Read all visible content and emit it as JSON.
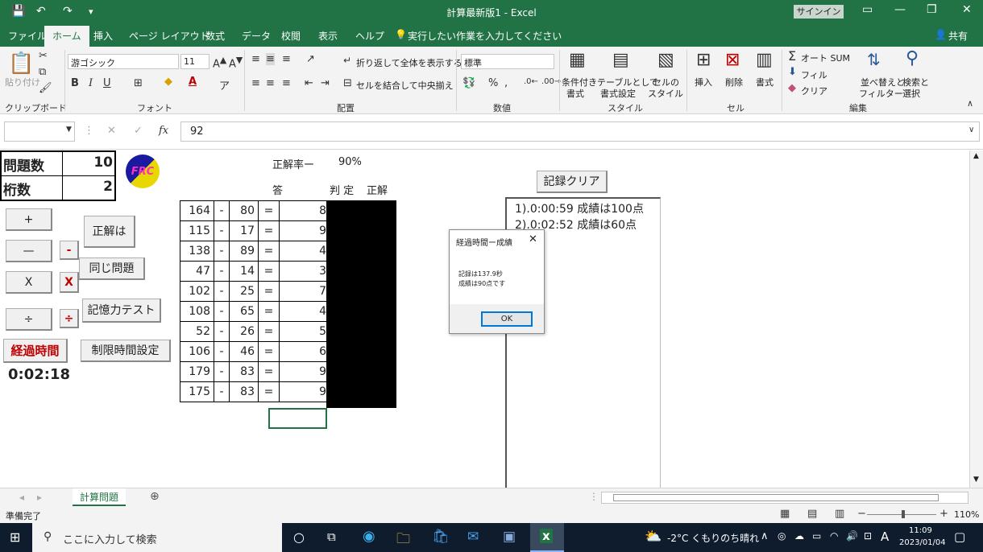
{
  "titlebar": {
    "title": "計算最新版1  -  Excel",
    "signin": "サインイン",
    "quick_access": [
      "save-icon",
      "undo-icon",
      "redo-icon",
      "customize-icon"
    ]
  },
  "menu": {
    "tabs": [
      "ファイル",
      "ホーム",
      "挿入",
      "ページ レイアウト",
      "数式",
      "データ",
      "校閲",
      "表示",
      "ヘルプ"
    ],
    "tellme": "実行したい作業を入力してください",
    "share": "共有"
  },
  "ribbon": {
    "clipboard": {
      "paste": "貼り付け",
      "group": "クリップボード"
    },
    "font": {
      "name": "游ゴシック",
      "size": "11",
      "group": "フォント",
      "bold": "B",
      "italic": "I",
      "underline": "U"
    },
    "align": {
      "wrap": "折り返して全体を表示する",
      "merge": "セルを結合して中央揃え",
      "group": "配置"
    },
    "number": {
      "format": "標準",
      "group": "数値",
      "percent": "%"
    },
    "styles": {
      "cond": [
        "条件付き",
        "書式"
      ],
      "table": [
        "テーブルとして",
        "書式設定"
      ],
      "cell": [
        "セルの",
        "スタイル"
      ],
      "group": "スタイル"
    },
    "cells": {
      "insert": "挿入",
      "delete": "削除",
      "format": "書式",
      "group": "セル"
    },
    "edit": {
      "autosum": "オート SUM",
      "fill": "フィル",
      "clear": "クリア",
      "sort": [
        "並べ替えと",
        "フィルター"
      ],
      "find": [
        "検索と",
        "選択"
      ],
      "group": "編集"
    }
  },
  "formula_bar": {
    "namebox": "",
    "fx": "fx",
    "value": "92"
  },
  "sheet": {
    "info": {
      "q_label": "問題数",
      "q_value": "10",
      "d_label": "桁数",
      "d_value": "2"
    },
    "logo": "FRC",
    "rate_label": "正解率ー",
    "rate_value": "90%",
    "headers": {
      "answer": "答",
      "judge": "判 定",
      "correct": "正解"
    },
    "rows": [
      [
        "164",
        "-",
        "80",
        "=",
        "84"
      ],
      [
        "115",
        "-",
        "17",
        "=",
        "98"
      ],
      [
        "138",
        "-",
        "89",
        "=",
        "49"
      ],
      [
        "47",
        "-",
        "14",
        "=",
        "33"
      ],
      [
        "102",
        "-",
        "25",
        "=",
        "77"
      ],
      [
        "108",
        "-",
        "65",
        "=",
        "43"
      ],
      [
        "52",
        "-",
        "26",
        "=",
        "52"
      ],
      [
        "106",
        "-",
        "46",
        "=",
        "60"
      ],
      [
        "179",
        "-",
        "83",
        "=",
        "96"
      ],
      [
        "175",
        "-",
        "83",
        "=",
        "92"
      ]
    ],
    "buttons": {
      "plus": "+",
      "minus": "—",
      "times": "X",
      "divide": "÷",
      "minus_red": "-",
      "times_red": "X",
      "divide_red": "÷",
      "answer": "正解は",
      "same": "同じ問題",
      "memory": "記憶力テスト",
      "elapsed": "経過時間",
      "limit": "制限時間設定",
      "clear": "記録クリア"
    },
    "elapsed_value": "0:02:18",
    "records": [
      "1).0:00:59 成績は100点",
      "2).0:02:52 成績は60点"
    ]
  },
  "dialog": {
    "title": "経過時間ー成績",
    "line1": "記録は137.9秒",
    "line2": "成績は90点です",
    "ok": "OK"
  },
  "sheet_tabs": {
    "active": "計算問題"
  },
  "status": {
    "text": "準備完了",
    "zoom": "110%"
  },
  "taskbar": {
    "search": "ここに入力して検索",
    "weather": "-2°C くもりのち晴れ",
    "ime": "A",
    "time": "11:09",
    "date": "2023/01/04"
  },
  "colors": {
    "excel_green": "#217346",
    "red": "#c00000",
    "taskbar": "#0f1c2e"
  }
}
